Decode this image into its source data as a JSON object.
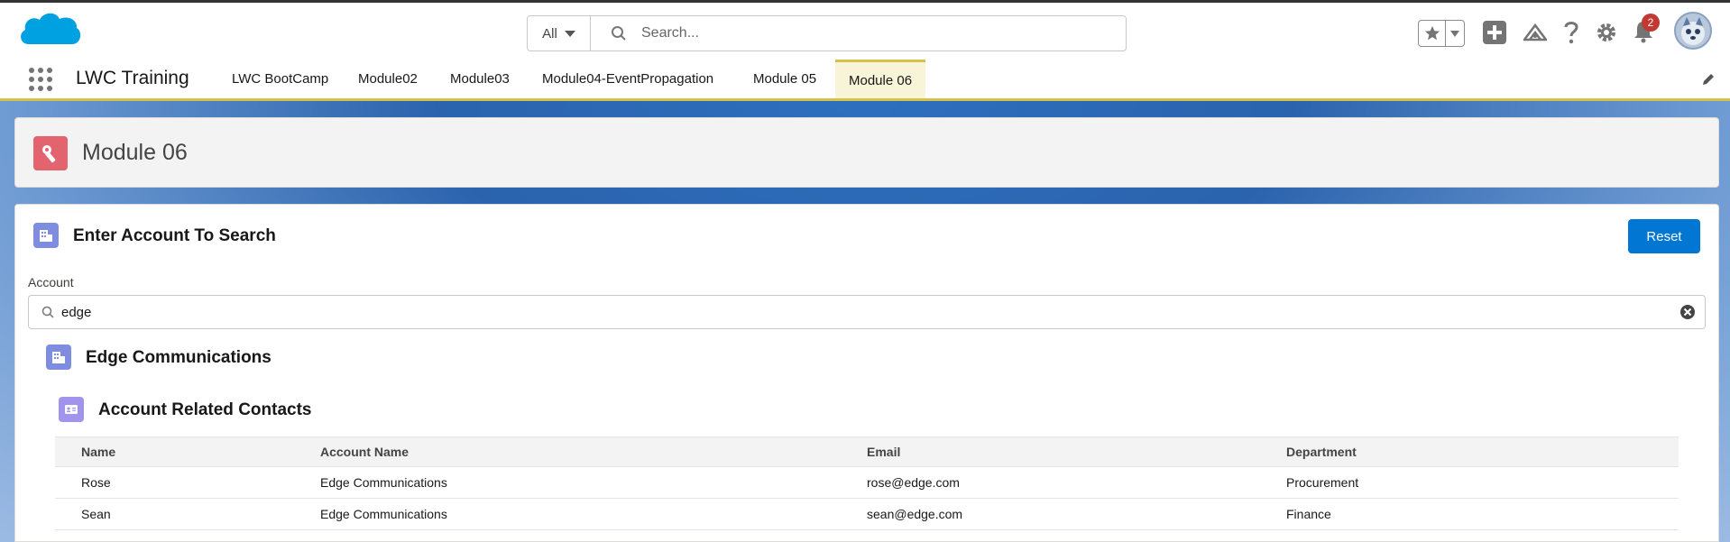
{
  "header": {
    "search_scope": "All",
    "search_placeholder": "Search...",
    "notification_count": "2"
  },
  "nav": {
    "app_name": "LWC Training",
    "tabs": [
      "LWC BootCamp",
      "Module02",
      "Module03",
      "Module04-EventPropagation",
      "Module 05",
      "Module 06"
    ],
    "active_tab": "Module 06"
  },
  "page_header": {
    "title": "Module 06"
  },
  "search_card": {
    "title": "Enter Account To Search",
    "reset_label": "Reset",
    "account_label": "Account",
    "account_value": "edge"
  },
  "result": {
    "account_name": "Edge Communications",
    "contacts_title": "Account Related Contacts",
    "columns": [
      "Name",
      "Account Name",
      "Email",
      "Department"
    ],
    "rows": [
      [
        "Rose",
        "Edge Communications",
        "rose@edge.com",
        "Procurement"
      ],
      [
        "Sean",
        "Edge Communications",
        "sean@edge.com",
        "Finance"
      ]
    ]
  },
  "colors": {
    "brand_blue": "#0176d3",
    "nav_accent": "#d6c24a",
    "page_icon": "#e3646e",
    "account_icon": "#7f8de1",
    "contact_icon": "#a094ed"
  }
}
